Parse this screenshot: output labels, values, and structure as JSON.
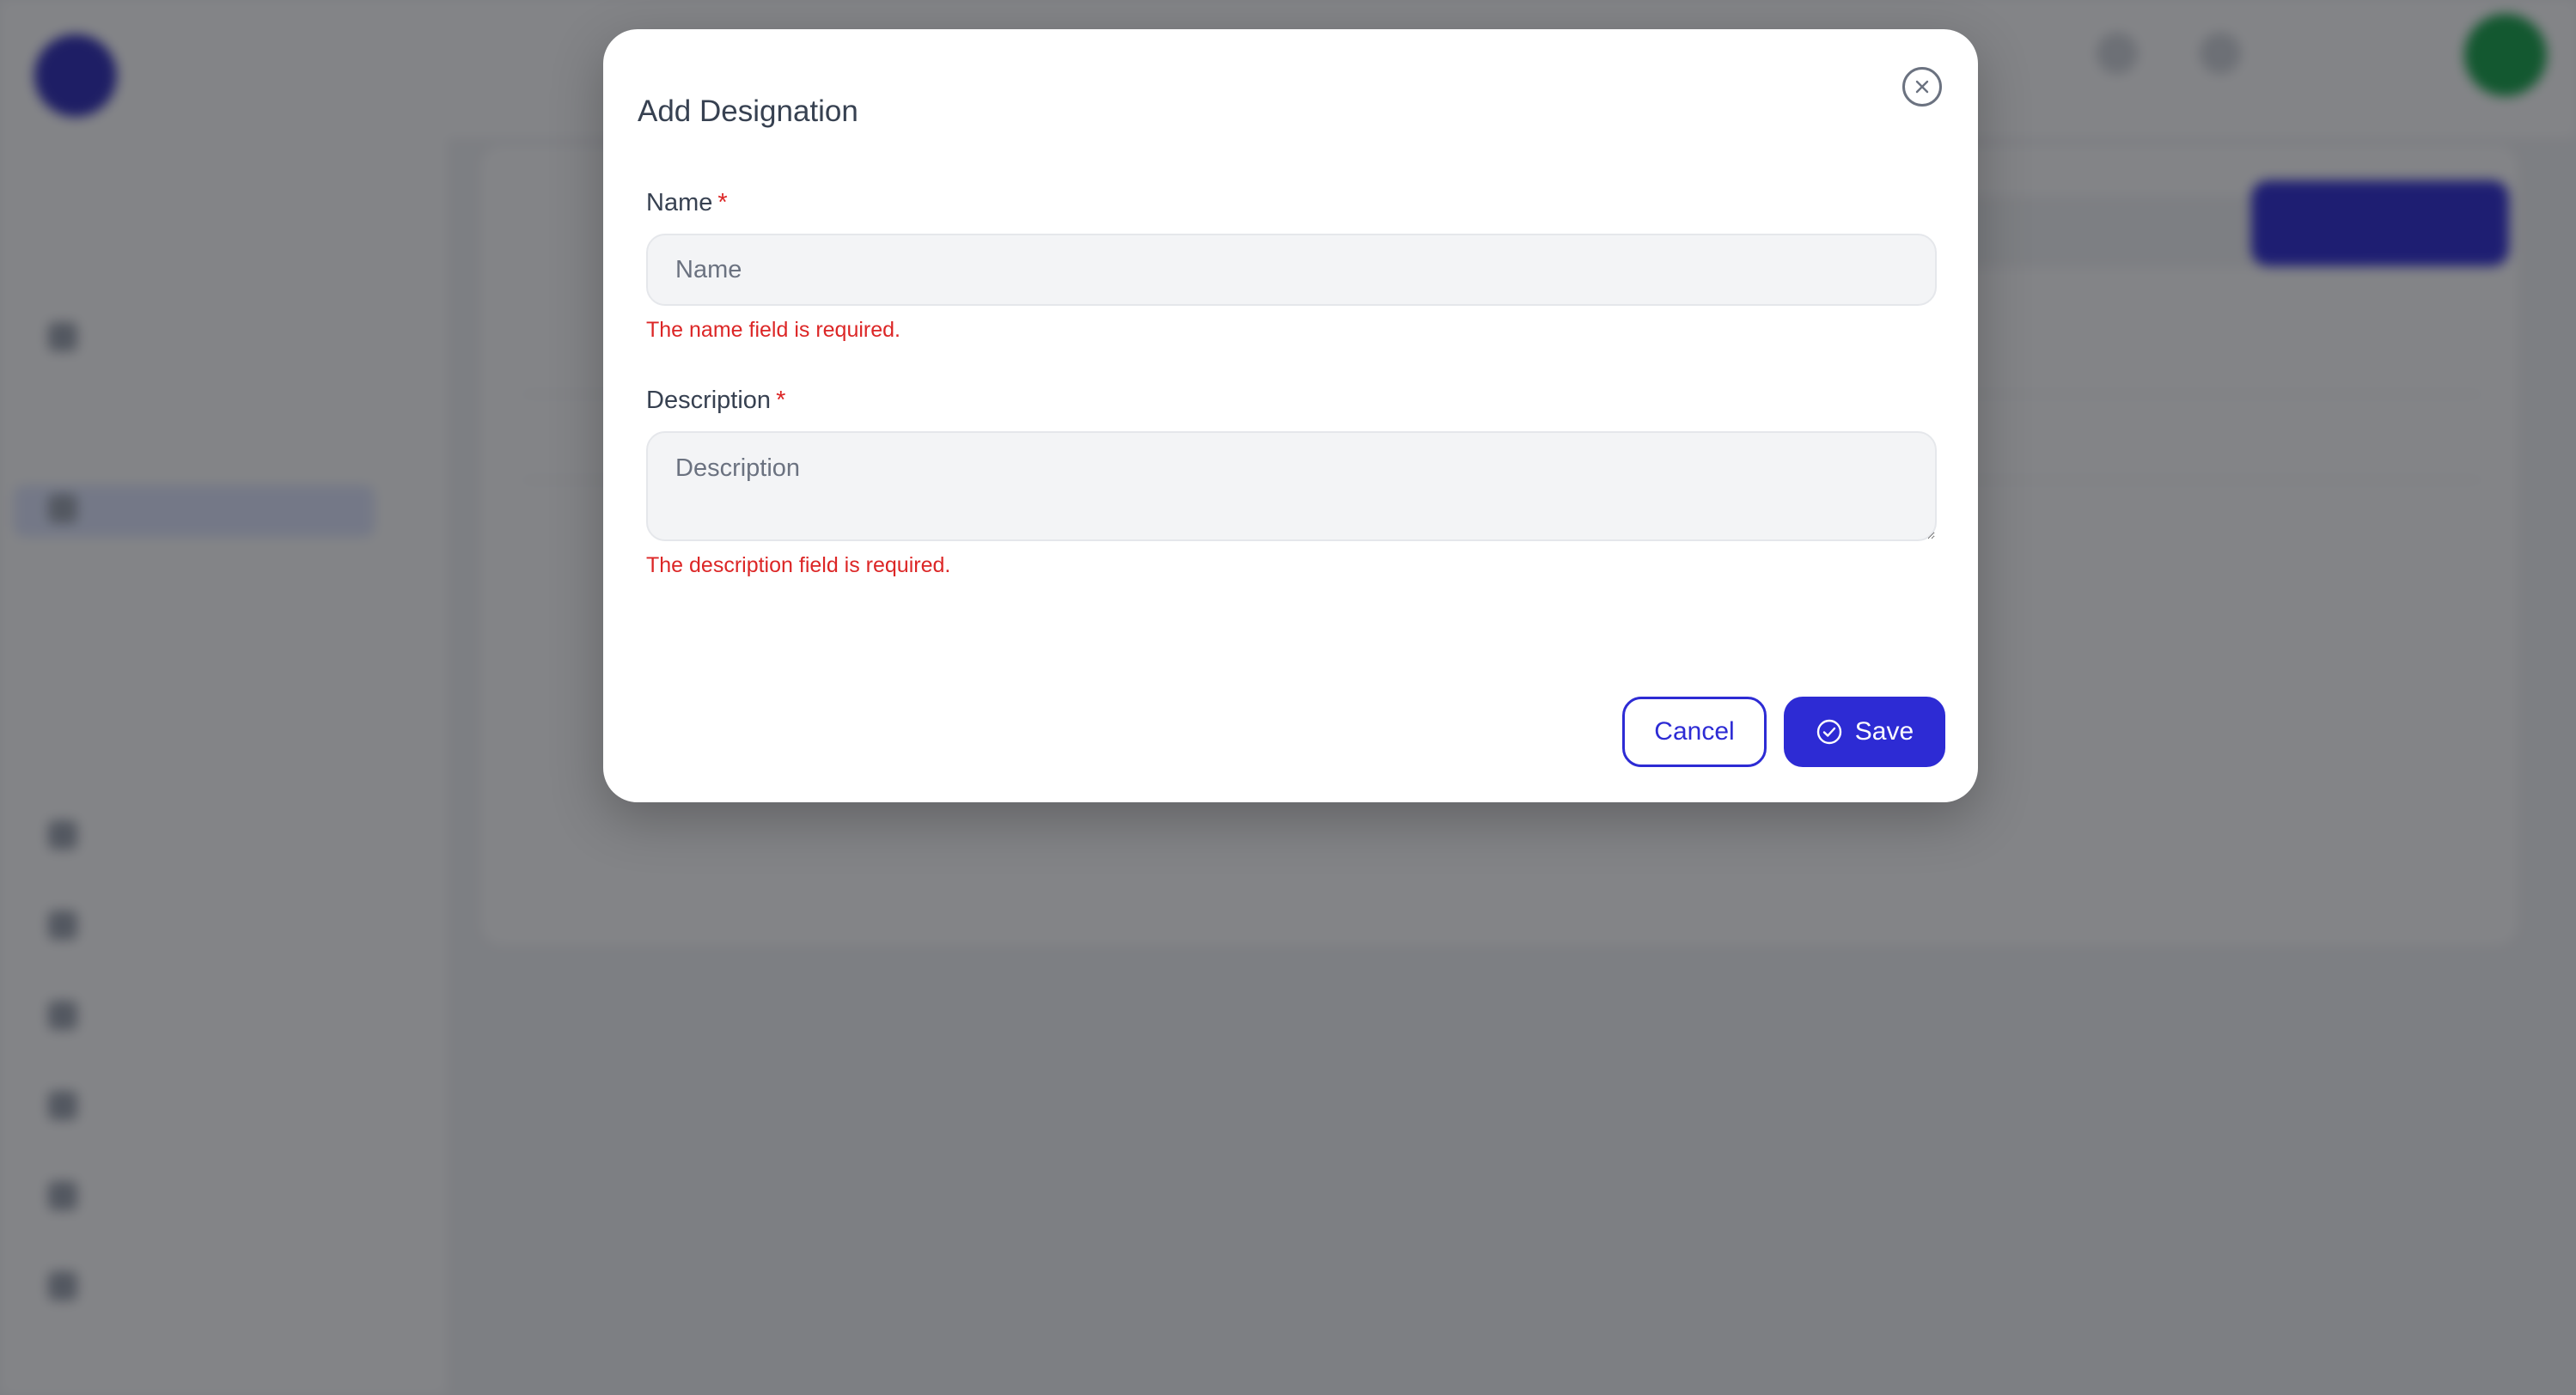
{
  "modal": {
    "title": "Add Designation",
    "name_field": {
      "label": "Name",
      "required_marker": "*",
      "placeholder": "Name",
      "value": "",
      "error": "The name field is required."
    },
    "description_field": {
      "label": "Description",
      "required_marker": "*",
      "placeholder": "Description",
      "value": "",
      "error": "The description field is required."
    },
    "cancel_label": "Cancel",
    "save_label": "Save",
    "icons": {
      "close": "close-circle-icon",
      "save": "check-circle-icon"
    }
  },
  "colors": {
    "primary": "#2d2bd4",
    "error": "#dc2626",
    "overlay": "rgba(17,19,24,0.52)",
    "input_bg": "#f3f4f6"
  }
}
